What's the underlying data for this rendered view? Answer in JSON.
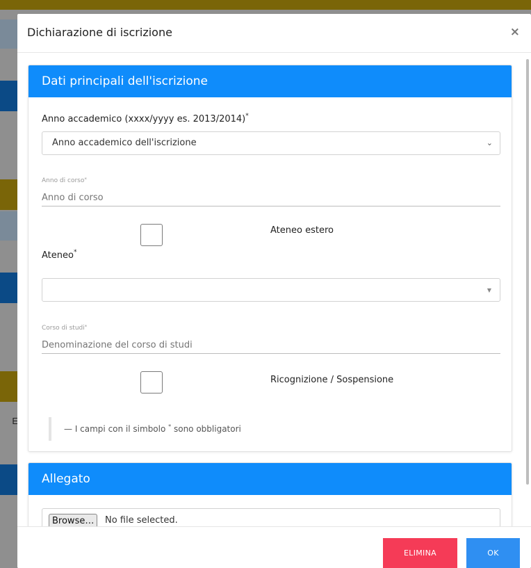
{
  "background": {
    "partial_label": "E"
  },
  "modal": {
    "title": "Dichiarazione di iscrizione",
    "close_symbol": "×"
  },
  "section_main": {
    "title": "Dati principali dell'iscrizione",
    "anno_accademico": {
      "label": "Anno accademico (xxxx/yyyy es. 2013/2014)",
      "required_mark": "*",
      "selected": "Anno accademico dell'iscrizione"
    },
    "anno_corso": {
      "label": "Anno di corso",
      "required_mark": "*",
      "placeholder": "Anno di corso"
    },
    "ateneo_estero": {
      "label": "Ateneo estero",
      "checked": false
    },
    "ateneo": {
      "label": "Ateneo",
      "required_mark": "*",
      "selected": ""
    },
    "corso_studi": {
      "label": "Corso di studi",
      "required_mark": "*",
      "placeholder": "Denominazione del corso di studi"
    },
    "ricognizione": {
      "label": "Ricognizione / Sospensione",
      "checked": false
    },
    "note": {
      "prefix": "— I campi con il simbolo",
      "required_mark": "*",
      "suffix": "sono obbligatori"
    }
  },
  "section_attachment": {
    "title": "Allegato",
    "browse_label": "Browse…",
    "file_status": "No file selected."
  },
  "footer": {
    "delete_label": "ELIMINA",
    "ok_label": "OK"
  },
  "colors": {
    "header_blue": "#0f8cfb",
    "delete_red": "#f53b57",
    "ok_blue": "#2f8ff2",
    "overlay_gray": "#8f8f8f"
  },
  "icons": {
    "close": "close-icon",
    "select_arrow": "chevron-down-icon",
    "select2_arrow": "caret-down-icon"
  }
}
